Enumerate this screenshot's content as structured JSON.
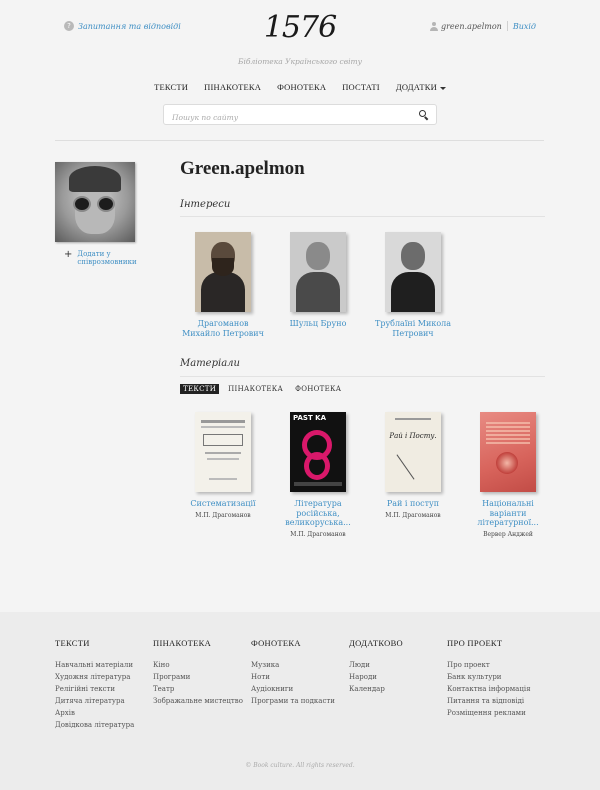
{
  "header": {
    "faq_label": "Запитання та відповіді",
    "logo": "1576",
    "tagline": "Бібліотека Українського світу",
    "username": "green.apelmon",
    "logout": "Вихід"
  },
  "nav": {
    "items": [
      "ТЕКСТИ",
      "ПІНАКОТЕКА",
      "ФОНОТЕКА",
      "ПОСТАТІ",
      "ДОДАТКИ"
    ]
  },
  "search": {
    "placeholder": "Пошук по сайту",
    "value": ""
  },
  "profile": {
    "name": "Green.apelmon",
    "add_friend": "Додати у співрозмовники"
  },
  "interests": {
    "title": "Інтереси",
    "items": [
      {
        "name": "Драгоманов Михайло Петрович"
      },
      {
        "name": "Шульц Бруно"
      },
      {
        "name": "Трублаїні Микола Петрович"
      }
    ]
  },
  "materials": {
    "title": "Матеріали",
    "tabs": [
      "ТЕКСТИ",
      "ПІНАКОТЕКА",
      "ФОНОТЕКА"
    ],
    "active_tab": "ТЕКСТИ",
    "items": [
      {
        "title": "Систематизації",
        "author": "М.П. Драгоманов"
      },
      {
        "title": "Література російська, великоруська...",
        "author": "М.П. Драгоманов",
        "cover_text": "PAST KA"
      },
      {
        "title": "Рай і поступ",
        "author": "М.П. Драгоманов",
        "cover_text": "Рай і Посту."
      },
      {
        "title": "Національні варіанти літературної...",
        "author": "Вервер Анджей"
      }
    ]
  },
  "footer": {
    "columns": [
      {
        "title": "ТЕКСТИ",
        "items": [
          "Навчальні матеріали",
          "Художня література",
          "Релігійні тексти",
          "Дитяча література",
          "Архів",
          "Довідкова література"
        ]
      },
      {
        "title": "ПІНАКОТЕКА",
        "items": [
          "Кіно",
          "Програми",
          "Театр",
          "Зображальне мистецтво"
        ]
      },
      {
        "title": "ФОНОТЕКА",
        "items": [
          "Музика",
          "Ноти",
          "Аудіокниги",
          "Програми та подкасти"
        ]
      },
      {
        "title": "ДОДАТКОВО",
        "items": [
          "Люди",
          "Народи",
          "Календар"
        ]
      },
      {
        "title": "ПРО ПРОЕКТ",
        "items": [
          "Про проект",
          "Банк культури",
          "Контактна інформація",
          "Питання та відповіді",
          "Розміщення реклами"
        ]
      }
    ],
    "copyright": "© Book culture. All rights reserved."
  },
  "colors": {
    "link": "#3f8fc4",
    "background": "#f4f4f4",
    "footer_bg": "#ececec"
  }
}
